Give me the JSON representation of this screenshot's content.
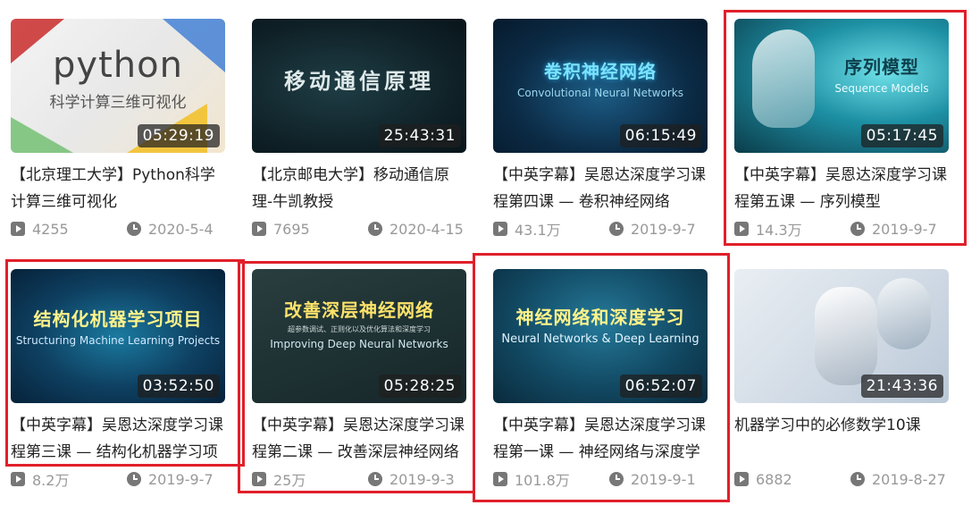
{
  "cards": [
    {
      "thumb_text": "python",
      "thumb_sub": "科学计算三维可视化",
      "duration": "05:29:19",
      "title": "【北京理工大学】Python科学计算三维可视化",
      "views": "4255",
      "date": "2020-5-4"
    },
    {
      "thumb_text": "移动通信原理",
      "duration": "25:43:31",
      "title": "【北京邮电大学】移动通信原理-牛凯教授",
      "views": "7695",
      "date": "2020-4-15"
    },
    {
      "thumb_text": "卷积神经网络",
      "thumb_sub": "Convolutional Neural Networks",
      "duration": "06:15:49",
      "title": "【中英字幕】吴恩达深度学习课程第四课 — 卷积神经网络",
      "views": "43.1万",
      "date": "2019-9-7"
    },
    {
      "thumb_text": "序列模型",
      "thumb_sub": "Sequence Models",
      "duration": "05:17:45",
      "title": "【中英字幕】吴恩达深度学习课程第五课 — 序列模型",
      "views": "14.3万",
      "date": "2019-9-7"
    },
    {
      "thumb_text": "结构化机器学习项目",
      "thumb_sub": "Structuring Machine Learning Projects",
      "duration": "03:52:50",
      "title": "【中英字幕】吴恩达深度学习课程第三课 — 结构化机器学习项目",
      "views": "8.2万",
      "date": "2019-9-7"
    },
    {
      "thumb_text": "改善深层神经网络",
      "thumb_tiny": "超参数调试、正则化以及优化算法和深度学习",
      "thumb_sub": "Improving Deep Neural Networks",
      "duration": "05:28:25",
      "title": "【中英字幕】吴恩达深度学习课程第二课 — 改善深层神经网络",
      "views": "25万",
      "date": "2019-9-3"
    },
    {
      "thumb_text": "神经网络和深度学习",
      "thumb_sub": "Neural Networks & Deep Learning",
      "duration": "06:52:07",
      "title": "【中英字幕】吴恩达深度学习课程第一课 — 神经网络与深度学习",
      "views": "101.8万",
      "date": "2019-9-1"
    },
    {
      "duration": "21:43:36",
      "title": "机器学习中的必修数学10课",
      "views": "6882",
      "date": "2019-8-27"
    }
  ],
  "icons": {
    "views": "play-icon",
    "date": "clock-icon"
  },
  "colors": {
    "highlight": "#e0202a",
    "meta": "#999999"
  }
}
